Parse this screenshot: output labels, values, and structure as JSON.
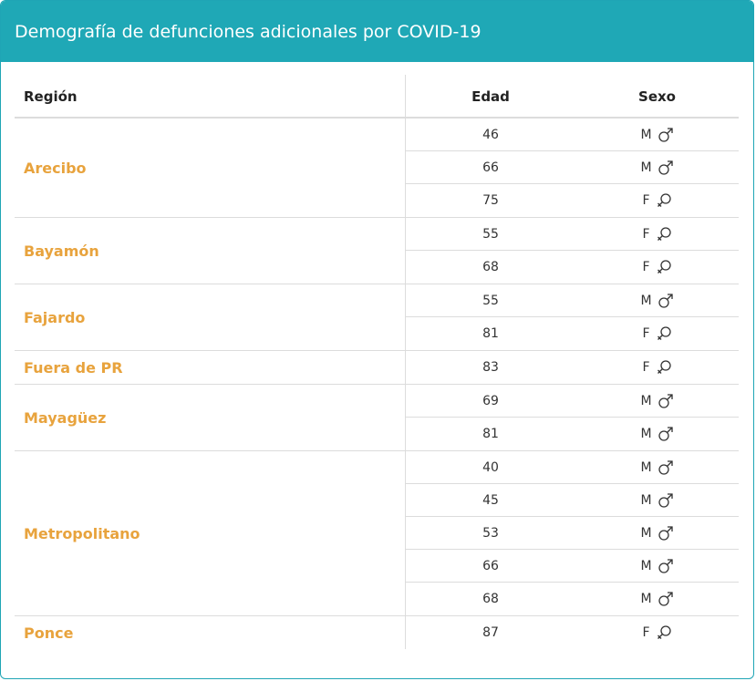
{
  "header": {
    "title": "Demografía de defunciones adicionales por COVID-19"
  },
  "columns": {
    "region": "Región",
    "age": "Edad",
    "sex": "Sexo"
  },
  "groups": [
    {
      "region": "Arecibo",
      "rows": [
        {
          "age": "46",
          "sex": "M",
          "icon": "male-icon"
        },
        {
          "age": "66",
          "sex": "M",
          "icon": "male-icon"
        },
        {
          "age": "75",
          "sex": "F",
          "icon": "female-icon"
        }
      ]
    },
    {
      "region": "Bayamón",
      "rows": [
        {
          "age": "55",
          "sex": "F",
          "icon": "female-icon"
        },
        {
          "age": "68",
          "sex": "F",
          "icon": "female-icon"
        }
      ]
    },
    {
      "region": "Fajardo",
      "rows": [
        {
          "age": "55",
          "sex": "M",
          "icon": "male-icon"
        },
        {
          "age": "81",
          "sex": "F",
          "icon": "female-icon"
        }
      ]
    },
    {
      "region": "Fuera de PR",
      "rows": [
        {
          "age": "83",
          "sex": "F",
          "icon": "female-icon"
        }
      ]
    },
    {
      "region": "Mayagüez",
      "rows": [
        {
          "age": "69",
          "sex": "M",
          "icon": "male-icon"
        },
        {
          "age": "81",
          "sex": "M",
          "icon": "male-icon"
        }
      ]
    },
    {
      "region": "Metropolitano",
      "rows": [
        {
          "age": "40",
          "sex": "M",
          "icon": "male-icon"
        },
        {
          "age": "45",
          "sex": "M",
          "icon": "male-icon"
        },
        {
          "age": "53",
          "sex": "M",
          "icon": "male-icon"
        },
        {
          "age": "66",
          "sex": "M",
          "icon": "male-icon"
        },
        {
          "age": "68",
          "sex": "M",
          "icon": "male-icon"
        }
      ]
    },
    {
      "region": "Ponce",
      "rows": [
        {
          "age": "87",
          "sex": "F",
          "icon": "female-icon"
        }
      ]
    }
  ],
  "colors": {
    "header_bg": "#1fa8b6",
    "region_text": "#e8a33d",
    "border": "#dcdcdc"
  }
}
